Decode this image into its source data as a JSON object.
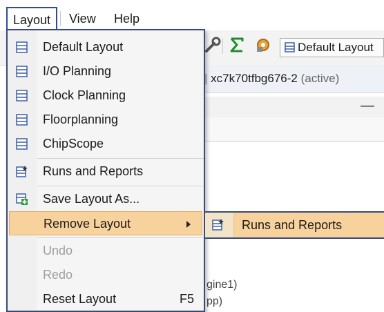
{
  "menubar": {
    "items": [
      "Layout",
      "View",
      "Help"
    ]
  },
  "toolbar": {
    "icons": [
      "wrench-icon",
      "sigma-icon",
      "gear-icon"
    ],
    "layout_select": {
      "value": "Default Layout",
      "icon": "layout-icon"
    }
  },
  "project_bar": {
    "device": "xc7k70tfbg676-2",
    "status": "(active)"
  },
  "panel": {
    "minimize": "—"
  },
  "background_text": {
    "line1": "gine1)",
    "line2": "pp)"
  },
  "layout_menu": {
    "items": [
      {
        "label": "Default Layout",
        "icon": "layout-icon"
      },
      {
        "label": "I/O Planning",
        "icon": "layout-icon"
      },
      {
        "label": "Clock Planning",
        "icon": "layout-icon"
      },
      {
        "label": "Floorplanning",
        "icon": "layout-icon"
      },
      {
        "label": "ChipScope",
        "icon": "layout-icon"
      },
      {
        "label": "Runs and Reports",
        "icon": "layout-star-icon"
      },
      {
        "label": "Save Layout As...",
        "icon": "layout-save-icon"
      },
      {
        "label": "Remove Layout",
        "icon": "",
        "highlighted": true,
        "has_submenu": true
      },
      {
        "label": "Undo",
        "disabled": true
      },
      {
        "label": "Redo",
        "disabled": true
      },
      {
        "label": "Reset Layout",
        "shortcut": "F5"
      }
    ]
  },
  "submenu": {
    "items": [
      {
        "label": "Runs and Reports",
        "icon": "layout-star-icon"
      }
    ]
  },
  "colors": {
    "highlight": "#f8d29c",
    "menu_border": "#3a4a78",
    "disabled_text": "#9e9e9e"
  }
}
